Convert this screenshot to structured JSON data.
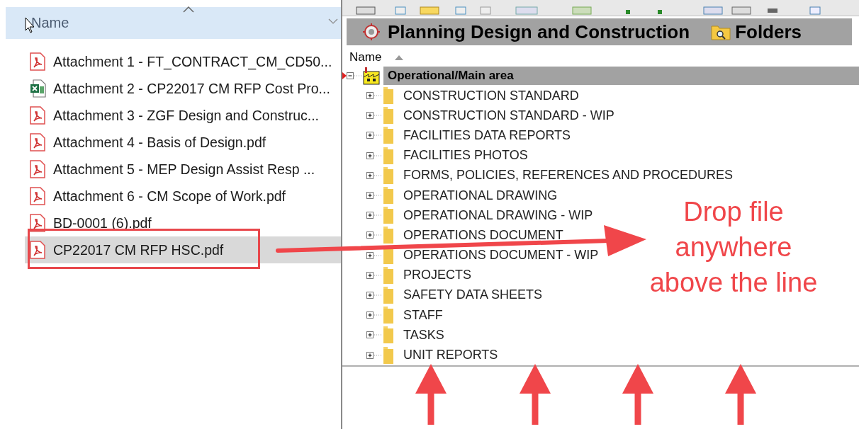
{
  "file_list": {
    "column_header": "Name",
    "files": [
      {
        "name": "Attachment 1 - FT_CONTRACT_CM_CD50...",
        "kind": "pdf",
        "selected": false
      },
      {
        "name": "Attachment 2 - CP22017 CM RFP Cost Pro...",
        "kind": "spreadsheet",
        "selected": false
      },
      {
        "name": "Attachment 3 - ZGF Design and Construc...",
        "kind": "pdf",
        "selected": false
      },
      {
        "name": "Attachment 4 - Basis of Design.pdf",
        "kind": "pdf",
        "selected": false
      },
      {
        "name": "Attachment 5 - MEP Design Assist Resp ...",
        "kind": "pdf",
        "selected": false
      },
      {
        "name": "Attachment 6 - CM Scope of Work.pdf",
        "kind": "pdf",
        "selected": false
      },
      {
        "name": "BD-0001 (6).pdf",
        "kind": "pdf",
        "selected": false
      },
      {
        "name": "CP22017 CM RFP HSC.pdf",
        "kind": "pdf",
        "selected": true
      }
    ]
  },
  "folder_panel": {
    "title": "Planning Design and Construction",
    "folders_label": "Folders",
    "column_header": "Name",
    "root": {
      "label": "Operational/Main area",
      "expanded": true,
      "children": [
        {
          "label": "CONSTRUCTION STANDARD",
          "expanded": false
        },
        {
          "label": "CONSTRUCTION STANDARD - WIP",
          "expanded": false
        },
        {
          "label": "FACILITIES DATA REPORTS",
          "expanded": false
        },
        {
          "label": "FACILITIES PHOTOS",
          "expanded": false
        },
        {
          "label": "FORMS, POLICIES, REFERENCES AND PROCEDURES",
          "expanded": false
        },
        {
          "label": "OPERATIONAL DRAWING",
          "expanded": false
        },
        {
          "label": "OPERATIONAL DRAWING - WIP",
          "expanded": false
        },
        {
          "label": "OPERATIONS DOCUMENT",
          "expanded": false
        },
        {
          "label": "OPERATIONS DOCUMENT - WIP",
          "expanded": false
        },
        {
          "label": "PROJECTS",
          "expanded": false
        },
        {
          "label": "SAFETY DATA SHEETS",
          "expanded": false
        },
        {
          "label": "STAFF",
          "expanded": false
        },
        {
          "label": "TASKS",
          "expanded": false
        },
        {
          "label": "UNIT REPORTS",
          "expanded": false
        }
      ]
    }
  },
  "annotation": {
    "text": "Drop file anywhere above the line"
  }
}
